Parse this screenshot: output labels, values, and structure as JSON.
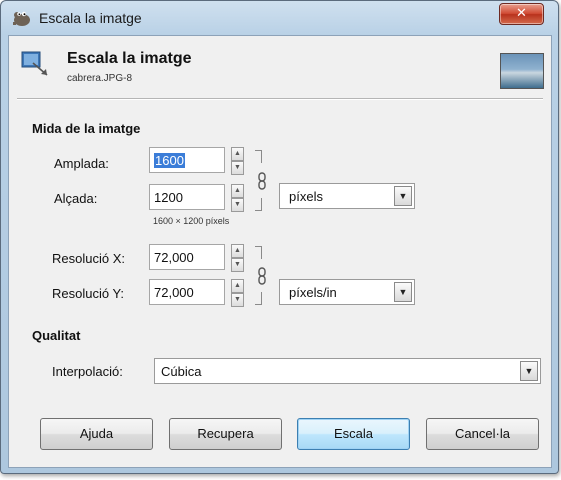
{
  "window": {
    "title": "Escala la imatge"
  },
  "header": {
    "title": "Escala la imatge",
    "subtitle": "cabrera.JPG-8"
  },
  "size_section": {
    "title": "Mida de la imatge",
    "width_label": "Amplada:",
    "width_value": "1600",
    "height_label": "Alçada:",
    "height_value": "1200",
    "dimensions_text": "1600 × 1200 píxels",
    "unit": "píxels",
    "res_x_label": "Resolució X:",
    "res_x_value": "72,000",
    "res_y_label": "Resolució Y:",
    "res_y_value": "72,000",
    "res_unit": "píxels/in"
  },
  "quality_section": {
    "title": "Qualitat",
    "interpolation_label": "Interpolació:",
    "interpolation_value": "Cúbica"
  },
  "buttons": {
    "help": "Ajuda",
    "reset": "Recupera",
    "scale": "Escala",
    "cancel": "Cancel·la"
  },
  "icons": {
    "app": "gimp-wilber-icon",
    "header": "scale-image-icon",
    "thumbnail": "image-thumbnail",
    "chain": "chain-link-icon"
  },
  "colors": {
    "selection": "#3b7dd8",
    "close_button": "#d04a33",
    "default_button": "#bee6fd"
  }
}
